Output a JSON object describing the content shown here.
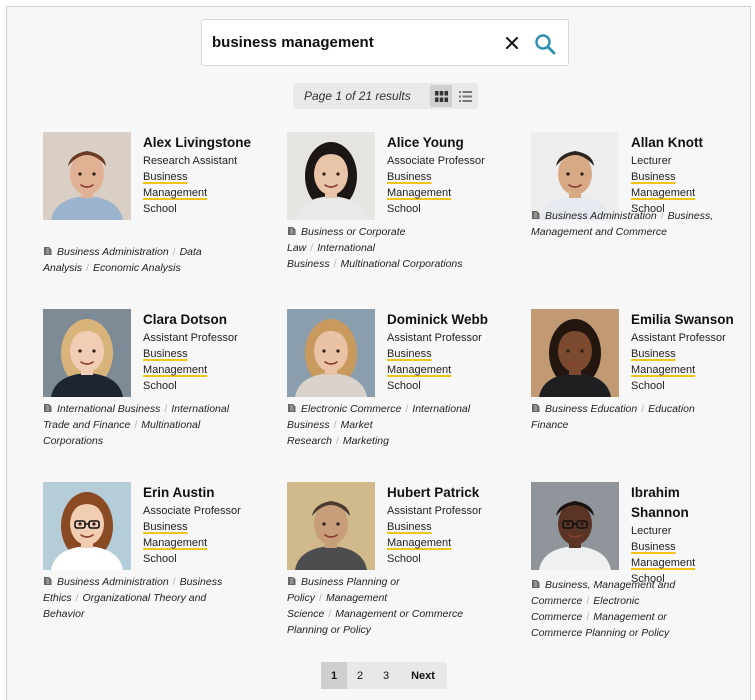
{
  "search": {
    "value": "business management",
    "placeholder": ""
  },
  "results": {
    "summary": "Page 1 of 21 results"
  },
  "colors": {
    "accent": "#2b8fb2",
    "highlight": "#f0c419"
  },
  "icons": {
    "clear": "close-icon",
    "search": "search-icon",
    "grid": "grid-view-icon",
    "list": "list-view-icon",
    "tag": "tag-icon"
  },
  "people": [
    {
      "name": "Alex Livingstone",
      "title": "Research Assistant",
      "dept": "Business Management",
      "school": "School",
      "tags": [
        "Business Administration",
        "Data Analysis",
        "Economic Analysis"
      ]
    },
    {
      "name": "Alice Young",
      "title": "Associate Professor",
      "dept": "Business Management",
      "school": "School",
      "tags": [
        "Business or Corporate Law",
        "International Business",
        "Multinational Corporations"
      ]
    },
    {
      "name": "Allan Knott",
      "title": "Lecturer",
      "dept": "Business Management",
      "school": "School",
      "tags": [
        "Business Administration",
        "Business, Management and Commerce"
      ]
    },
    {
      "name": "Clara Dotson",
      "title": "Assistant Professor",
      "dept": "Business Management",
      "school": "School",
      "tags": [
        "International Business",
        "International Trade and Finance",
        "Multinational Corporations"
      ]
    },
    {
      "name": "Dominick Webb",
      "title": "Assistant Professor",
      "dept": "Business Management",
      "school": "School",
      "tags": [
        "Electronic Commerce",
        "International Business",
        "Market Research",
        "Marketing"
      ]
    },
    {
      "name": "Emilia Swanson",
      "title": "Assistant Professor",
      "dept": "Business Management",
      "school": "School",
      "tags": [
        "Business Education",
        "Education Finance"
      ]
    },
    {
      "name": "Erin Austin",
      "title": "Associate Professor",
      "dept": "Business Management",
      "school": "School",
      "tags": [
        "Business Administration",
        "Business Ethics",
        "Organizational Theory and Behavior"
      ]
    },
    {
      "name": "Hubert Patrick",
      "title": "Assistant Professor",
      "dept": "Business Management",
      "school": "School",
      "tags": [
        "Business Planning or Policy",
        "Management Science",
        "Management or Commerce Planning or Policy"
      ]
    },
    {
      "name": "Ibrahim Shannon",
      "title": "Lecturer",
      "dept": "Business Management",
      "school": "School",
      "tags": [
        "Business, Management and Commerce",
        "Electronic Commerce",
        "Management or Commerce Planning or Policy"
      ]
    }
  ],
  "pagination": {
    "pages": [
      "1",
      "2",
      "3"
    ],
    "next": "Next"
  }
}
